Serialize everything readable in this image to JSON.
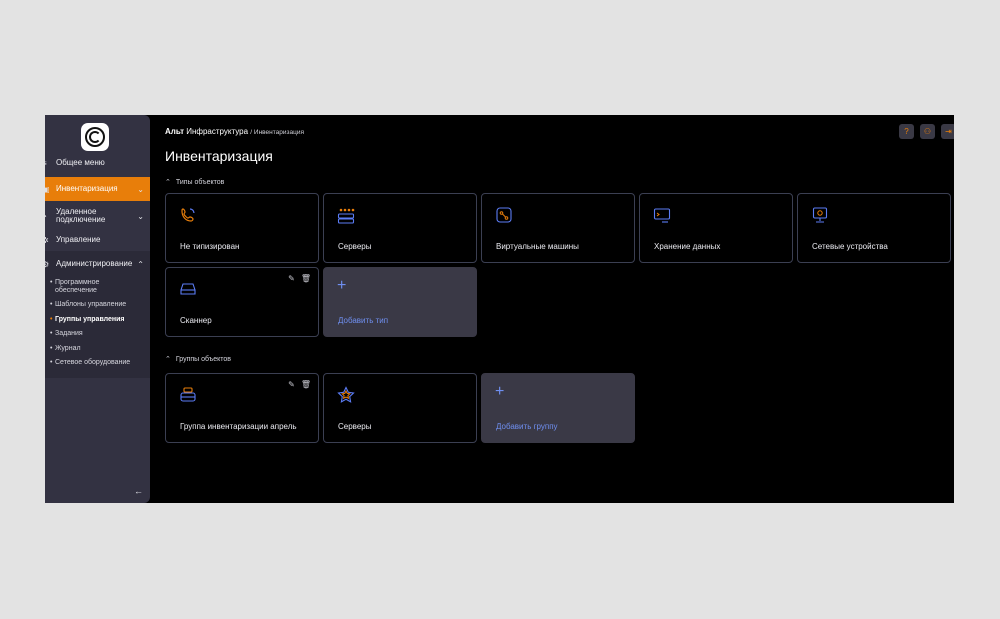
{
  "header": {
    "brand_bold": "Альт",
    "brand_rest": "Инфраструктура",
    "breadcrumb": "/ Инвентаризация",
    "page_title": "Инвентаризация",
    "buttons": [
      {
        "icon": "help-icon",
        "glyph": "?"
      },
      {
        "icon": "user-icon",
        "glyph": "⚇"
      },
      {
        "icon": "logout-icon",
        "glyph": "⇥"
      }
    ]
  },
  "sidebar": {
    "items": [
      {
        "label": "Общее меню",
        "icon": "menu-icon"
      },
      {
        "label": "Инвентаризация",
        "icon": "box-icon"
      },
      {
        "label": "Удаленное подключение",
        "icon": "remote-icon"
      },
      {
        "label": "Управление",
        "icon": "settings-icon"
      },
      {
        "label": "Администрирование",
        "icon": "admin-gear-icon"
      }
    ],
    "subitems": [
      {
        "label": "Программное обеспечение"
      },
      {
        "label": "Шаблоны управление"
      },
      {
        "label": "Группы управления"
      },
      {
        "label": "Задания"
      },
      {
        "label": "Журнал"
      },
      {
        "label": "Сетевое оборудование"
      }
    ],
    "collapse_glyph": "←"
  },
  "types_section": {
    "title": "Типы объектов",
    "cards": [
      {
        "label": "Не типизирован",
        "icon": "untyped-icon"
      },
      {
        "label": "Серверы",
        "icon": "servers-icon"
      },
      {
        "label": "Виртуальные машины",
        "icon": "vm-icon"
      },
      {
        "label": "Хранение данных",
        "icon": "storage-icon"
      },
      {
        "label": "Сетевые устройства",
        "icon": "network-device-icon"
      },
      {
        "label": "Сканнер",
        "icon": "scanner-icon"
      }
    ],
    "add_label": "Добавить тип"
  },
  "groups_section": {
    "title": "Группы объектов",
    "cards": [
      {
        "label": "Группа инвентаризации апрель",
        "icon": "group-icon"
      },
      {
        "label": "Серверы",
        "icon": "star-icon"
      }
    ],
    "add_label": "Добавить группу"
  },
  "colors": {
    "accent": "#e87e0a",
    "link": "#6f8ff0",
    "icon_blue": "#5b7cf5",
    "sidebar": "#333242",
    "card_border": "#3b3f52"
  }
}
